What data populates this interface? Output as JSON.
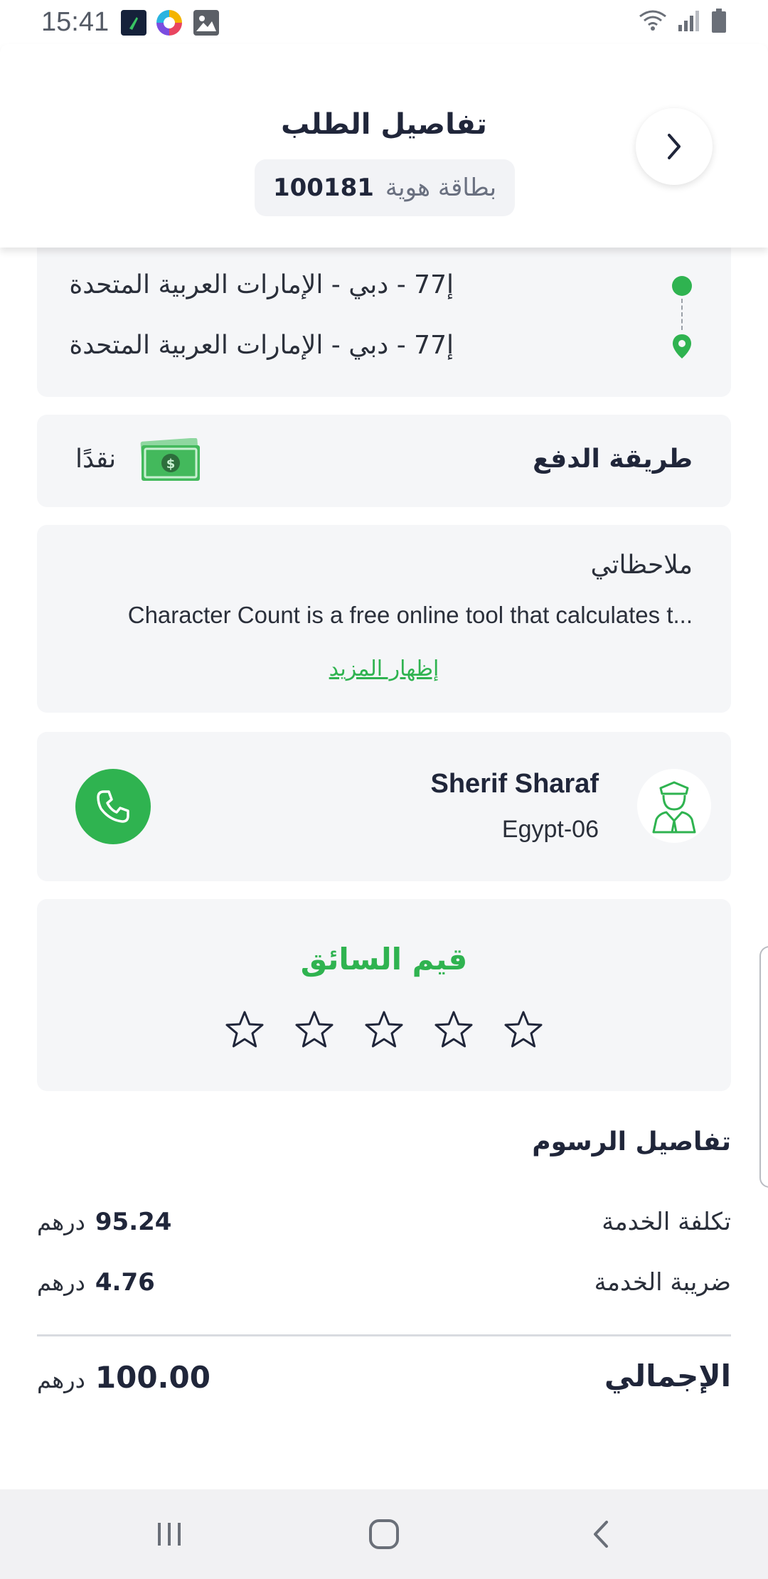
{
  "status_bar": {
    "time": "15:41",
    "notification_icons": [
      "app-icon",
      "colorful-app-icon",
      "gallery-icon"
    ],
    "system_icons": [
      "wifi-icon",
      "signal-icon",
      "battery-icon"
    ]
  },
  "header": {
    "title": "تفاصيل الطلب",
    "badge_label": "بطاقة هوية",
    "badge_value": "100181",
    "back_icon": "chevron-right-icon"
  },
  "route": {
    "pickup": "إ77 - دبي - الإمارات العربية المتحدة",
    "dropoff": "إ77 - دبي - الإمارات العربية المتحدة"
  },
  "payment": {
    "label": "طريقة الدفع",
    "method": "نقدًا",
    "icon": "cash-icon"
  },
  "notes": {
    "title": "ملاحظاتي",
    "text": "Character Count is a free online tool that calculates t...",
    "show_more": "إظهار المزيد"
  },
  "driver": {
    "name": "Sherif Sharaf",
    "plate": "Egypt-06",
    "avatar_icon": "driver-avatar-icon",
    "call_icon": "phone-icon"
  },
  "rating": {
    "title": "قيم السائق",
    "stars": 5,
    "value": 0
  },
  "fees": {
    "title": "تفاصيل الرسوم",
    "rows": [
      {
        "label": "تكلفة الخدمة",
        "amount": "95.24",
        "currency": "درهم"
      },
      {
        "label": "ضريبة الخدمة",
        "amount": "4.76",
        "currency": "درهم"
      }
    ],
    "total_label": "الإجمالي",
    "total_amount": "100.00",
    "total_currency": "درهم"
  },
  "colors": {
    "accent_green": "#2fb350",
    "card_bg": "#f5f6f8",
    "text_dark": "#20263a"
  }
}
